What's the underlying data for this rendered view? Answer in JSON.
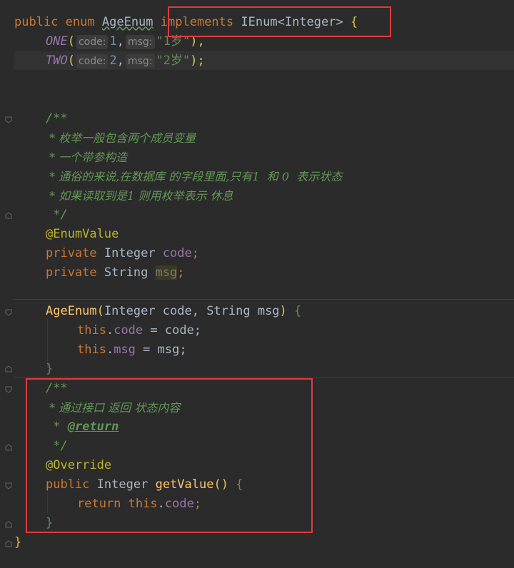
{
  "editor": {
    "line1": {
      "public": "public",
      "enum": "enum",
      "name": "AgeEnum",
      "implements": "implements",
      "iface": "IEnum",
      "lt": "<",
      "generic": "Integer",
      "gt": ">",
      "brace": "{"
    },
    "line2": {
      "constant": "ONE",
      "open": "(",
      "hint_code": "code:",
      "code_val": "1",
      "comma": ",",
      "hint_msg": "msg:",
      "msg_val": "\"1岁\"",
      "close": "),"
    },
    "line3": {
      "constant": "TWO",
      "open": "(",
      "hint_code": "code:",
      "code_val": "2",
      "comma": ",",
      "hint_msg": "msg:",
      "msg_val": "\"2岁\"",
      "close": ");"
    },
    "doc1": {
      "open": "/**",
      "l1": " * 枚举一般包含两个成员变量",
      "l2": " * 一个带参构造",
      "l3": " * 通俗的来说,在数据库 的字段里面,只有1  和 0  表示状态",
      "l4": " * 如果读取到是1 则用枚举表示 休息",
      "close": " */"
    },
    "annotation1": "@EnumValue",
    "field1": {
      "mod": "private",
      "type": "Integer",
      "name": "code",
      "semi": ";"
    },
    "field2": {
      "mod": "private",
      "type": "String",
      "name": "msg",
      "semi": ";"
    },
    "ctor": {
      "name": "AgeEnum",
      "open": "(",
      "params": "Integer code, String msg",
      "close": ")",
      "brace": "{",
      "stmt1_this": "this",
      "stmt1_dot": ".",
      "stmt1_field": "code",
      "stmt1_rest": " = code;",
      "stmt2_this": "this",
      "stmt2_dot": ".",
      "stmt2_field": "msg",
      "stmt2_rest": " = msg;",
      "end": "}"
    },
    "doc2": {
      "open": "/**",
      "l1": " * 通过接口 返回 状态内容",
      "l2_star": " * ",
      "l2_tag": "@return",
      "close": " */"
    },
    "annotation2": "@Override",
    "method": {
      "mod": "public",
      "type": "Integer",
      "name": "getValue",
      "parens": "()",
      "brace": "{",
      "ret": "return",
      "this": "this",
      "dot": ".",
      "field": "code",
      "semi": ";",
      "end": "}"
    },
    "class_end": "}"
  },
  "colors": {
    "background": "#2b2b2b",
    "keyword": "#cc7832",
    "string": "#6a8759",
    "number": "#6897bb",
    "field": "#9876aa",
    "annotation": "#bbb529",
    "method": "#ffc66d",
    "comment": "#629755",
    "highlight_box": "#e03c3c"
  }
}
